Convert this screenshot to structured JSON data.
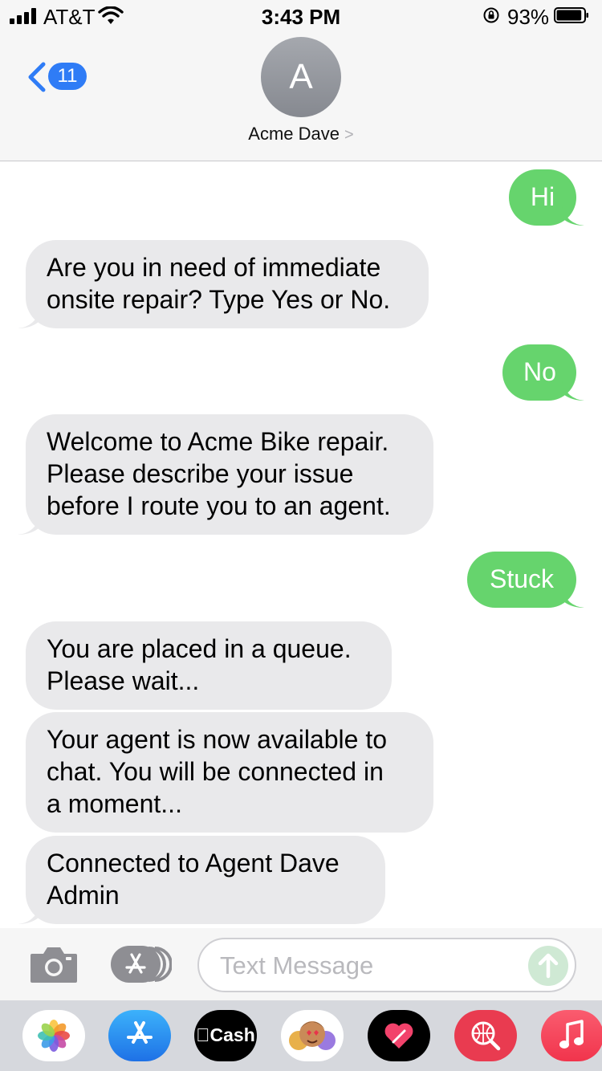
{
  "status_bar": {
    "carrier": "AT&T",
    "time": "3:43 PM",
    "battery_percent": "93%",
    "battery_level": 0.93
  },
  "header": {
    "back_badge": "11",
    "avatar_initial": "A",
    "contact_name": "Acme Dave",
    "chevron": ">"
  },
  "messages": [
    {
      "from": "me",
      "text": "Hi"
    },
    {
      "from": "them",
      "text": "Are you in need of immediate\nonsite repair? Type Yes or No."
    },
    {
      "from": "me",
      "text": "No"
    },
    {
      "from": "them",
      "text": "Welcome to Acme Bike repair.\nPlease describe your issue\nbefore I route you to an agent."
    },
    {
      "from": "me",
      "text": "Stuck"
    },
    {
      "from": "them",
      "text": "You are placed in a queue.\nPlease wait..."
    },
    {
      "from": "them",
      "text": "Your agent is now available to\nchat. You will be connected in\na moment..."
    },
    {
      "from": "them",
      "text": "Connected to Agent Dave\nAdmin"
    }
  ],
  "compose": {
    "placeholder": "Text Message",
    "value": ""
  },
  "app_drawer": {
    "apps": [
      {
        "name": "photos-icon"
      },
      {
        "name": "app-store-icon"
      },
      {
        "name": "apple-cash-icon",
        "label": "Cash"
      },
      {
        "name": "memoji-icon"
      },
      {
        "name": "digital-touch-icon"
      },
      {
        "name": "web-search-icon"
      },
      {
        "name": "music-icon"
      }
    ]
  },
  "colors": {
    "bubble_outgoing": "#66d46d",
    "bubble_incoming": "#e9e9eb",
    "accent_blue": "#2f7cf6"
  }
}
